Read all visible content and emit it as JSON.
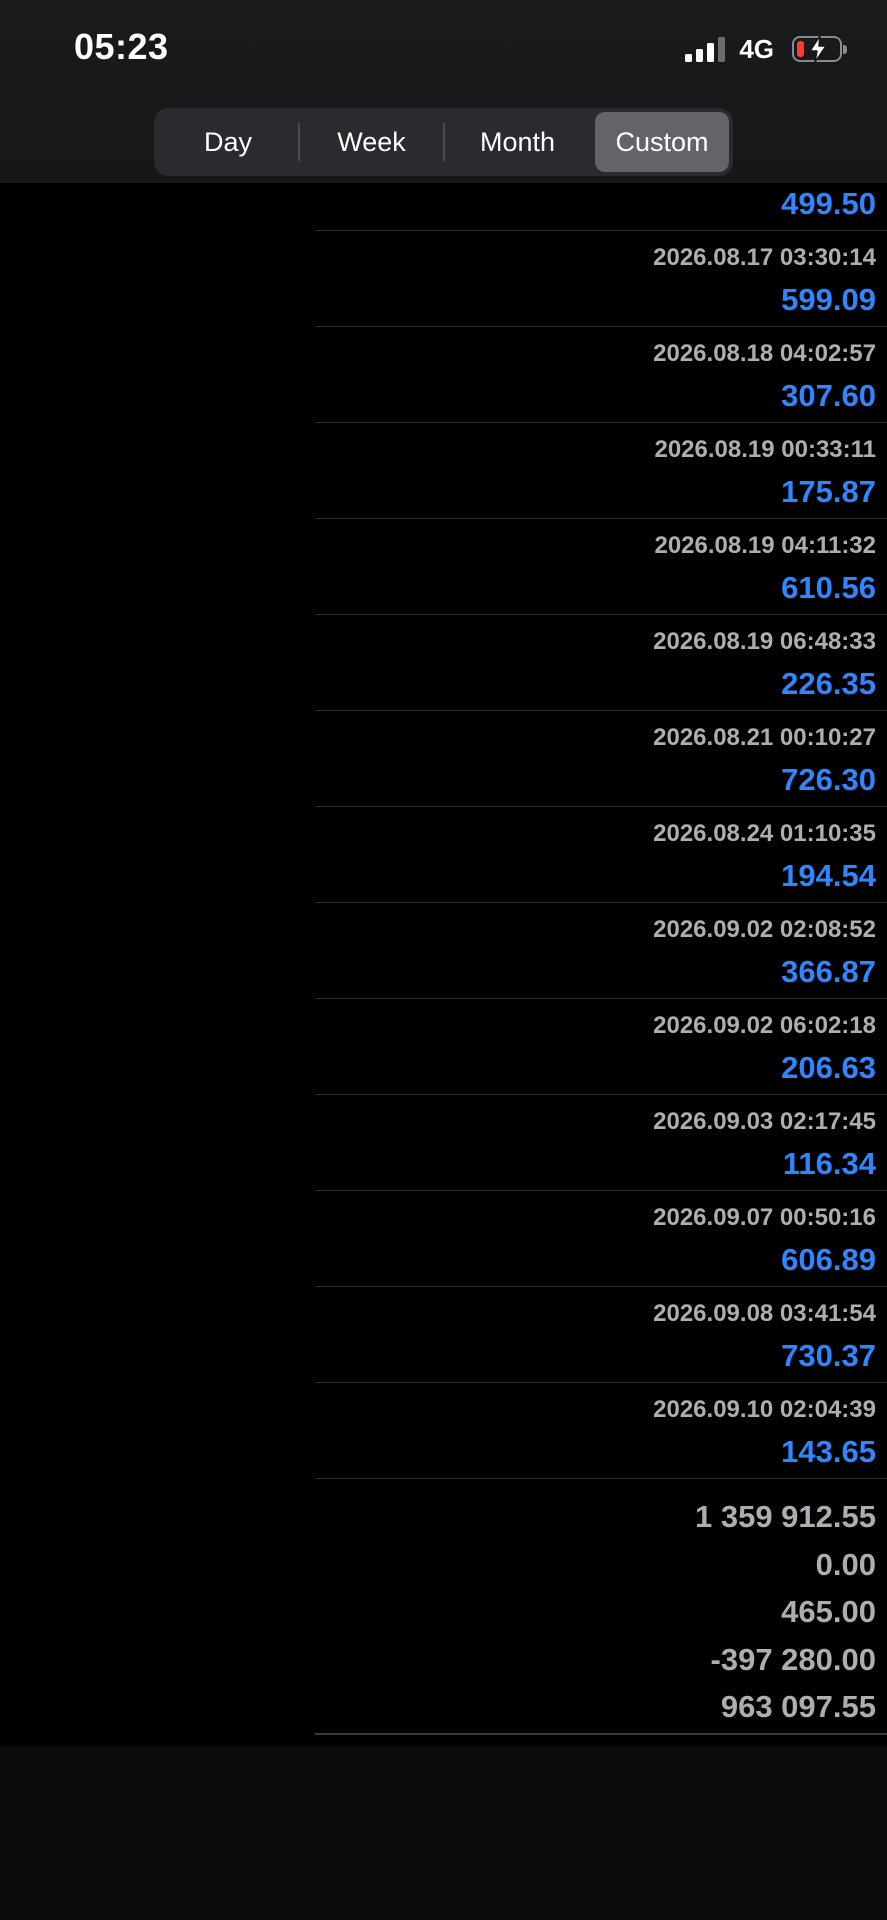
{
  "status": {
    "time": "05:23",
    "network": "4G"
  },
  "icons": {
    "signal": "cellular-signal-icon",
    "battery": "battery-charging-icon"
  },
  "colors": {
    "accent": "#2f86ff",
    "battery_low": "#ff3b30",
    "secondary_text": "#aeaeb2"
  },
  "segmented": {
    "day": "Day",
    "week": "Week",
    "month": "Month",
    "custom": "Custom",
    "selected": "Custom"
  },
  "transactions": {
    "first_amount": "499.50",
    "rows": [
      {
        "date": "2026.08.17 03:30:14",
        "amount": "599.09"
      },
      {
        "date": "2026.08.18 04:02:57",
        "amount": "307.60"
      },
      {
        "date": "2026.08.19 00:33:11",
        "amount": "175.87"
      },
      {
        "date": "2026.08.19 04:11:32",
        "amount": "610.56"
      },
      {
        "date": "2026.08.19 06:48:33",
        "amount": "226.35"
      },
      {
        "date": "2026.08.21 00:10:27",
        "amount": "726.30"
      },
      {
        "date": "2026.08.24 01:10:35",
        "amount": "194.54"
      },
      {
        "date": "2026.09.02 02:08:52",
        "amount": "366.87"
      },
      {
        "date": "2026.09.02 06:02:18",
        "amount": "206.63"
      },
      {
        "date": "2026.09.03 02:17:45",
        "amount": "116.34"
      },
      {
        "date": "2026.09.07 00:50:16",
        "amount": "606.89"
      },
      {
        "date": "2026.09.08 03:41:54",
        "amount": "730.37"
      },
      {
        "date": "2026.09.10 02:04:39",
        "amount": "143.65"
      }
    ]
  },
  "summary": [
    "1 359 912.55",
    "0.00",
    "465.00",
    "-397 280.00",
    "963 097.55"
  ]
}
